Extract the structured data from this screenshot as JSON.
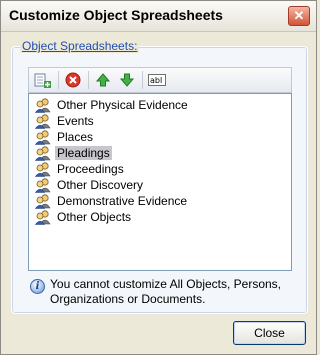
{
  "window": {
    "title": "Customize Object Spreadsheets",
    "close_glyph": "✕"
  },
  "group": {
    "label": "Object Spreadsheets:"
  },
  "toolbar": {
    "buttons": [
      {
        "name": "add-spreadsheet-icon"
      },
      {
        "name": "delete-icon"
      },
      {
        "name": "move-up-icon"
      },
      {
        "name": "move-down-icon"
      },
      {
        "name": "rename-icon",
        "text": "abl"
      }
    ]
  },
  "list": {
    "items": [
      {
        "label": "Other Physical Evidence",
        "selected": false
      },
      {
        "label": "Events",
        "selected": false
      },
      {
        "label": "Places",
        "selected": false
      },
      {
        "label": "Pleadings",
        "selected": true
      },
      {
        "label": "Proceedings",
        "selected": false
      },
      {
        "label": "Other Discovery",
        "selected": false
      },
      {
        "label": "Demonstrative Evidence",
        "selected": false
      },
      {
        "label": "Other Objects",
        "selected": false
      }
    ]
  },
  "info": {
    "line1": "You cannot customize All Objects, Persons,",
    "line2": "Organizations or Documents."
  },
  "buttons": {
    "close_label": "Close"
  },
  "colors": {
    "group_label": "#1f4fb3",
    "selection": "#c6c6cc",
    "delete_red": "#d9382a",
    "arrow_green": "#36a23a"
  }
}
